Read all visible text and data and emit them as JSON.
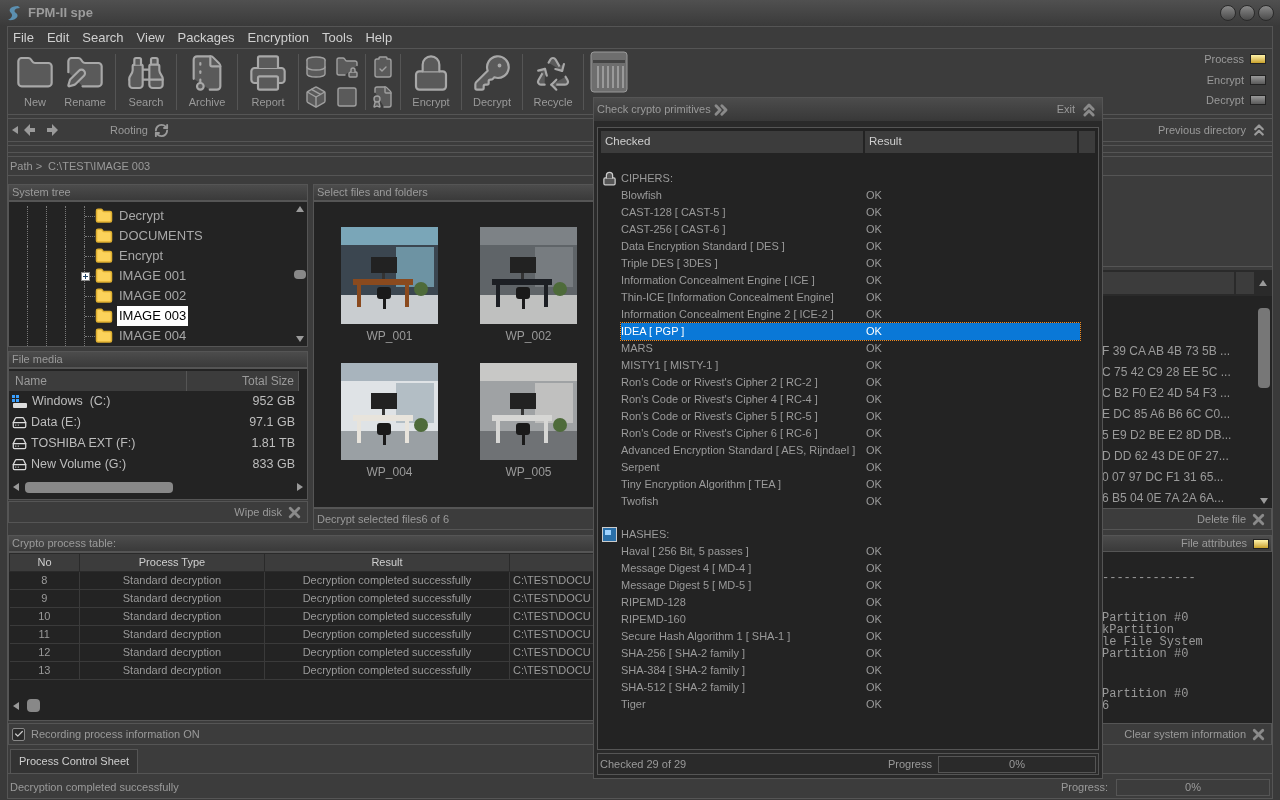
{
  "window": {
    "title": "FPM-II spe"
  },
  "menu": [
    "File",
    "Edit",
    "Search",
    "View",
    "Packages",
    "Encryption",
    "Tools",
    "Help"
  ],
  "toolbar": {
    "left": [
      "New",
      "Rename",
      "Search",
      "Archive",
      "Report"
    ],
    "right": [
      "Encrypt",
      "Decrypt",
      "Recycle"
    ]
  },
  "indicators": [
    {
      "label": "Process",
      "on": true
    },
    {
      "label": "Encrypt",
      "on": false
    },
    {
      "label": "Decrypt",
      "on": false
    }
  ],
  "nav": {
    "rooting": "Rooting",
    "previous": "Previous directory"
  },
  "path": {
    "label": "Path >",
    "value": "C:\\TEST\\IMAGE 003"
  },
  "system_tree": {
    "title": "System tree",
    "items": [
      {
        "label": "Decrypt",
        "selected": false,
        "expandable": false
      },
      {
        "label": "DOCUMENTS",
        "selected": false,
        "expandable": false
      },
      {
        "label": "Encrypt",
        "selected": false,
        "expandable": false
      },
      {
        "label": "IMAGE 001",
        "selected": false,
        "expandable": true
      },
      {
        "label": "IMAGE 002",
        "selected": false,
        "expandable": false
      },
      {
        "label": "IMAGE 003",
        "selected": true,
        "expandable": false
      },
      {
        "label": "IMAGE 004",
        "selected": false,
        "expandable": false
      }
    ]
  },
  "file_media": {
    "title": "File media",
    "columns": [
      "Name",
      "Total Size"
    ],
    "rows": [
      {
        "name": "Windows  (C:)",
        "size": "952 GB",
        "kind": "system"
      },
      {
        "name": "Data (E:)",
        "size": "97.1 GB",
        "kind": "drive"
      },
      {
        "name": "TOSHIBA EXT (F:)",
        "size": "1.81 TB",
        "kind": "drive"
      },
      {
        "name": "New Volume (G:)",
        "size": "833 GB",
        "kind": "drive"
      }
    ],
    "footer": "Wipe disk"
  },
  "files": {
    "title": "Select files and folders",
    "items": [
      {
        "label": "WP_001",
        "kind": "picture"
      },
      {
        "label": "WP_002",
        "kind": "picture"
      },
      {
        "label": "WP_004",
        "kind": "picture"
      },
      {
        "label": "WP_005",
        "kind": "picture"
      }
    ],
    "footer": "Decrypt selected files6 of 6"
  },
  "hex_view": {
    "lines": [
      "F 39 CA AB 4B 73 5B ...",
      "C 75 42 C9 28 EE 5C ...",
      "C B2 F0 E2 4D 54 F3 ...",
      "E DC 85 A6 B6 6C C0...",
      "5 E9 D2 BE E2 8D DB...",
      "D DD 62 43 DE 0F 27...",
      "0 07 97 DC F1 31 65...",
      "6 B5 04 0E 7A 2A 6A..."
    ],
    "footer": "Delete file"
  },
  "process_table": {
    "title": "Crypto process table:",
    "columns": [
      "No",
      "Process Type",
      "Result"
    ],
    "rows": [
      {
        "no": "8",
        "type": "Standard decryption",
        "result": "Decryption completed successfully",
        "column_4": "C:\\TEST\\DOCU"
      },
      {
        "no": "9",
        "type": "Standard decryption",
        "result": "Decryption completed successfully",
        "column_4": "C:\\TEST\\DOCU"
      },
      {
        "no": "10",
        "type": "Standard decryption",
        "result": "Decryption completed successfully",
        "column_4": "C:\\TEST\\DOCU"
      },
      {
        "no": "11",
        "type": "Standard decryption",
        "result": "Decryption completed successfully",
        "column_4": "C:\\TEST\\DOCU"
      },
      {
        "no": "12",
        "type": "Standard decryption",
        "result": "Decryption completed successfully",
        "column_4": "C:\\TEST\\DOCU"
      },
      {
        "no": "13",
        "type": "Standard decryption",
        "result": "Decryption completed successfully",
        "column_4": "C:\\TEST\\DOCU"
      }
    ]
  },
  "recording": {
    "label": "Recording process information ON",
    "checked": true
  },
  "file_attributes": {
    "title": "File attributes",
    "on": true,
    "blocks": [
      [
        "-------------"
      ],
      [
        "Partition #0",
        "kPartition",
        "le File System",
        "Partition #0"
      ],
      [
        "Partition #0",
        "6"
      ]
    ],
    "footer": "Clear system information"
  },
  "tabs": [
    {
      "label": "Process Control Sheet",
      "selected": true
    }
  ],
  "status_bar": {
    "message": "Decryption completed successfully",
    "progress_label": "Progress:",
    "progress": {
      "level": 0,
      "reading": "0%"
    }
  },
  "dialog": {
    "title": "Check crypto primitives",
    "exit": "Exit",
    "columns": [
      "Checked",
      "Result"
    ],
    "groups": [
      {
        "name": "CIPHERS:",
        "kind": "ciphers",
        "items": [
          {
            "name": "Blowfish",
            "result": "OK",
            "selected": false
          },
          {
            "name": "CAST-128 [ CAST-5 ]",
            "result": "OK",
            "selected": false
          },
          {
            "name": "CAST-256 [ CAST-6 ]",
            "result": "OK",
            "selected": false
          },
          {
            "name": "Data Encryption Standard [ DES ]",
            "result": "OK",
            "selected": false
          },
          {
            "name": "Triple DES [ 3DES ]",
            "result": "OK",
            "selected": false
          },
          {
            "name": "Information Concealment Engine [ ICE ]",
            "result": "OK",
            "selected": false
          },
          {
            "name": "Thin-ICE [Information Concealment Engine]",
            "result": "OK",
            "selected": false
          },
          {
            "name": "Information Concealment Engine 2 [ ICE-2 ]",
            "result": "OK",
            "selected": false
          },
          {
            "name": "IDEA [ PGP ]",
            "result": "OK",
            "selected": true
          },
          {
            "name": "MARS",
            "result": "OK",
            "selected": false
          },
          {
            "name": "MISTY1 [ MISTY-1 ]",
            "result": "OK",
            "selected": false
          },
          {
            "name": "Ron's Code or Rivest's Cipher 2 [ RC-2 ]",
            "result": "OK",
            "selected": false
          },
          {
            "name": "Ron's Code or Rivest's Cipher 4 [ RC-4 ]",
            "result": "OK",
            "selected": false
          },
          {
            "name": "Ron's Code or Rivest's Cipher 5 [ RC-5 ]",
            "result": "OK",
            "selected": false
          },
          {
            "name": "Ron's Code or Rivest's Cipher 6 [ RC-6 ]",
            "result": "OK",
            "selected": false
          },
          {
            "name": "Advanced Encryption Standard [ AES, Rijndael ]",
            "result": "OK",
            "selected": false
          },
          {
            "name": "Serpent",
            "result": "OK",
            "selected": false
          },
          {
            "name": "Tiny Encryption Algorithm [ TEA ]",
            "result": "OK",
            "selected": false
          },
          {
            "name": "Twofish",
            "result": "OK",
            "selected": false
          }
        ]
      },
      {
        "name": "HASHES:",
        "kind": "hashes",
        "items": [
          {
            "name": "Haval [ 256 Bit, 5 passes ]",
            "result": "OK",
            "selected": false
          },
          {
            "name": "Message Digest 4 [ MD-4 ]",
            "result": "OK",
            "selected": false
          },
          {
            "name": "Message Digest 5 [ MD-5 ]",
            "result": "OK",
            "selected": false
          },
          {
            "name": "RIPEMD-128",
            "result": "OK",
            "selected": false
          },
          {
            "name": "RIPEMD-160",
            "result": "OK",
            "selected": false
          },
          {
            "name": "Secure Hash Algorithm 1 [ SHA-1 ]",
            "result": "OK",
            "selected": false
          },
          {
            "name": "SHA-256 [ SHA-2 family ]",
            "result": "OK",
            "selected": false
          },
          {
            "name": "SHA-384 [ SHA-2 family ]",
            "result": "OK",
            "selected": false
          },
          {
            "name": "SHA-512 [ SHA-2 family ]",
            "result": "OK",
            "selected": false
          },
          {
            "name": "Tiger",
            "result": "OK",
            "selected": false
          }
        ]
      }
    ],
    "footer": {
      "summary": "Checked 29 of 29",
      "progress_label": "Progress",
      "progress": {
        "level": 0,
        "reading": "0%"
      }
    }
  }
}
